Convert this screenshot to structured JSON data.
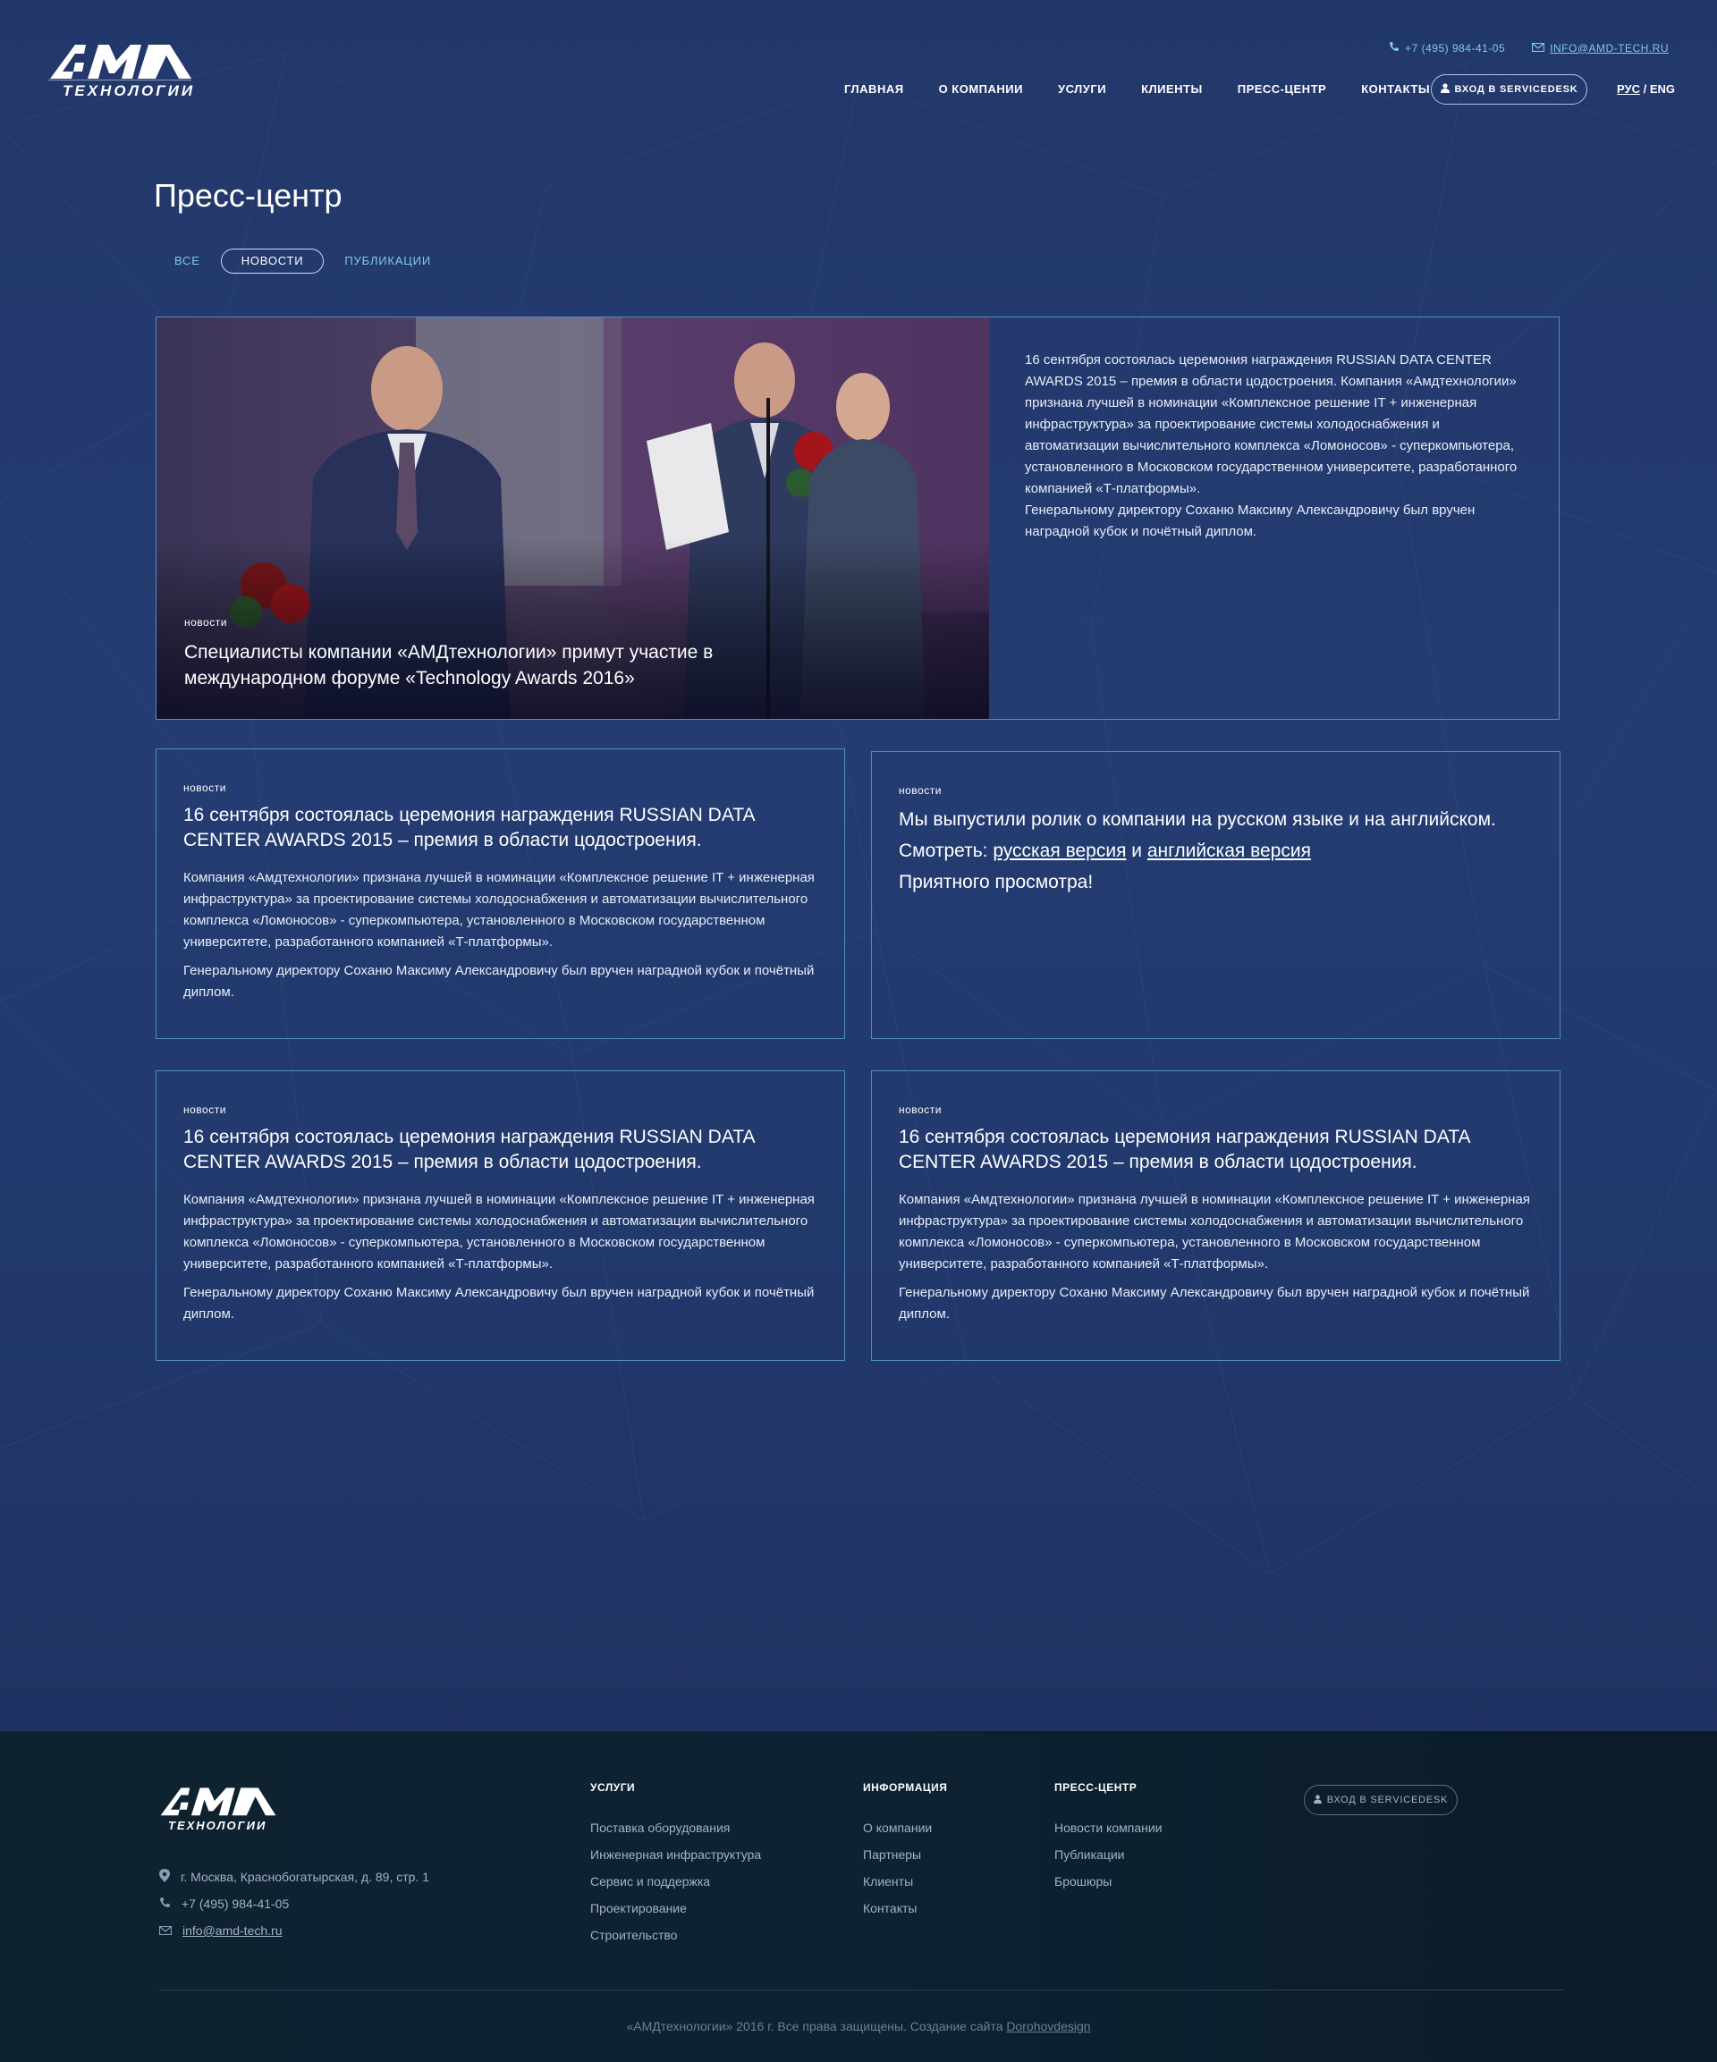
{
  "header": {
    "logo_text": "АМД",
    "logo_sub": "ТЕХНОЛОГИИ",
    "phone": "+7 (495) 984-41-05",
    "email": "INFO@AMD-TECH.RU",
    "nav": [
      "ГЛАВНАЯ",
      "О КОМПАНИИ",
      "УСЛУГИ",
      "КЛИЕНТЫ",
      "ПРЕСС-ЦЕНТР",
      "КОНТАКТЫ"
    ],
    "servicedesk": "ВХОД В SERVICEDESK",
    "lang_ru": "РУС",
    "lang_sep": "/",
    "lang_en": "ENG"
  },
  "page": {
    "title": "Пресс-центр",
    "tabs": [
      {
        "label": "ВСЕ",
        "active": false
      },
      {
        "label": "НОВОСТИ",
        "active": true
      },
      {
        "label": "ПУБЛИКАЦИИ",
        "active": false
      }
    ]
  },
  "featured": {
    "category": "новости",
    "title": "Специалисты компании «АМДтехнологии» примут участие в международном форуме «Technology Awards 2016»",
    "text": "16 сентября состоялась церемония награждения RUSSIAN DATA CENTER AWARDS 2015 – премия в области цодостроения. Компания «Амдтехнологии» признана лучшей в номинации «Комплексное решение IT + инженерная инфраструктура» за проектирование системы холодоснабжения и автоматизации вычислительного комплекса «Ломоносов» - суперкомпьютера, установленного в Московском государственном университете, разработанного компанией «Т-платформы».",
    "text2": "Генеральному директору Соханю Максиму Александровичу был вручен наградной кубок и почётный диплом."
  },
  "cards": [
    {
      "category": "новости",
      "title": "16 сентября состоялась церемония награждения RUSSIAN DATA CENTER AWARDS 2015 – премия в области цодостроения.",
      "p1": "Компания «Амдтехнологии» признана лучшей в номинации «Комплексное решение IT + инженерная инфраструктура» за проектирование системы холодоснабжения и автоматизации вычислительного комплекса «Ломоносов» - суперкомпьютера, установленного в Московском государственном университете, разработанного компанией «Т-платформы».",
      "p2": "Генеральному директору Соханю Максиму Александровичу был вручен наградной кубок и почётный диплом."
    },
    {
      "category": "новости",
      "line1": "Мы выпустили ролик о компании на русском языке и на английском.",
      "line2_prefix": "Смотреть: ",
      "link_ru": "русская версия",
      "and": " и ",
      "link_en": "английская версия",
      "line3": "Приятного просмотра!"
    },
    {
      "category": "новости",
      "title": "16 сентября состоялась церемония награждения RUSSIAN DATA CENTER AWARDS 2015 – премия в области цодостроения.",
      "p1": "Компания «Амдтехнологии» признана лучшей в номинации «Комплексное решение IT + инженерная инфраструктура» за проектирование системы холодоснабжения и автоматизации вычислительного комплекса «Ломоносов» - суперкомпьютера, установленного в Московском государственном университете, разработанного компанией «Т-платформы».",
      "p2": "Генеральному директору Соханю Максиму Александровичу был вручен наградной кубок и почётный диплом."
    },
    {
      "category": "новости",
      "title": "16 сентября состоялась церемония награждения RUSSIAN DATA CENTER AWARDS 2015 – премия в области цодостроения.",
      "p1": "Компания «Амдтехнологии» признана лучшей в номинации «Комплексное решение IT + инженерная инфраструктура» за проектирование системы холодоснабжения и автоматизации вычислительного комплекса «Ломоносов» - суперкомпьютера, установленного в Московском государственном университете, разработанного компанией «Т-платформы».",
      "p2": "Генеральному директору Соханю Максиму Александровичу был вручен наградной кубок и почётный диплом."
    }
  ],
  "footer": {
    "logo_text": "АМД",
    "logo_sub": "ТЕХНОЛОГИИ",
    "address": "г. Москва, Краснобогатырская, д. 89, стр. 1",
    "phone": "+7 (495) 984-41-05",
    "email": "info@amd-tech.ru",
    "col_services": {
      "heading": "УСЛУГИ",
      "items": [
        "Поставка оборудования",
        "Инженерная инфраструктура",
        "Сервис и поддержка",
        "Проектирование",
        "Строительство"
      ]
    },
    "col_info": {
      "heading": "ИНФОРМАЦИЯ",
      "items": [
        "О компании",
        "Партнеры",
        "Клиенты",
        "Контакты"
      ]
    },
    "col_press": {
      "heading": "ПРЕСС-ЦЕНТР",
      "items": [
        "Новости компании",
        "Публикации",
        "Брошюры"
      ]
    },
    "servicedesk": "ВХОД В SERVICEDESK",
    "copyright": "«АМДтехнологии» 2016 г. Все права защищены. Создание сайта ",
    "designer": "Dorohovdesign"
  },
  "colors": {
    "accent": "#7ec8ec",
    "border": "#4f8dbf",
    "bg": "#23386a",
    "footer_bg": "#0d2232"
  },
  "icons": [
    "phone-icon",
    "mail-icon",
    "user-icon",
    "location-icon"
  ]
}
